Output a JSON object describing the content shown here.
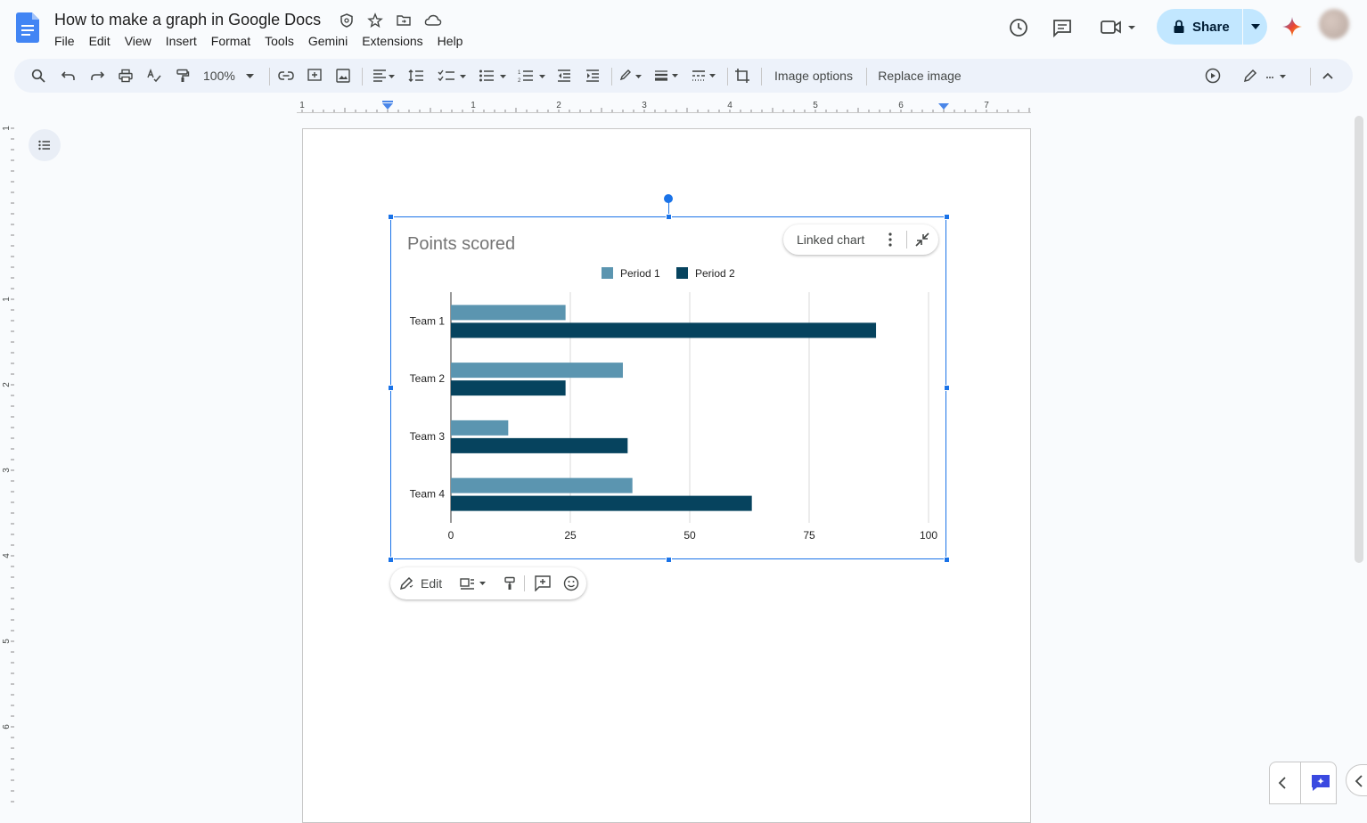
{
  "app": {
    "title": "How to make a graph in Google Docs",
    "menu": [
      "File",
      "Edit",
      "View",
      "Insert",
      "Format",
      "Tools",
      "Gemini",
      "Extensions",
      "Help"
    ],
    "share_label": "Share",
    "icons": {
      "title_icons": [
        "security-icon",
        "star-icon",
        "move-folder-icon",
        "cloud-status-icon"
      ],
      "right_icons": [
        "version-history-icon",
        "comments-icon",
        "meet-icon",
        "gemini-icon"
      ]
    }
  },
  "toolbar": {
    "zoom": "100%",
    "image_options": "Image options",
    "replace_image": "Replace image"
  },
  "ruler": {
    "h_labels": [
      "1",
      "1",
      "2",
      "3",
      "4",
      "5",
      "6",
      "7"
    ],
    "v_labels": [
      "1",
      "1",
      "2",
      "3",
      "4",
      "5",
      "6"
    ]
  },
  "chart_overlay": {
    "linked_chart_label": "Linked chart"
  },
  "image_toolbar": {
    "edit_label": "Edit"
  },
  "chart_data": {
    "type": "bar",
    "orientation": "horizontal",
    "title": "Points scored",
    "categories": [
      "Team 1",
      "Team 2",
      "Team 3",
      "Team 4"
    ],
    "series": [
      {
        "name": "Period 1",
        "values": [
          24,
          36,
          12,
          38
        ],
        "color": "#5b95b0"
      },
      {
        "name": "Period 2",
        "values": [
          89,
          24,
          37,
          63
        ],
        "color": "#06435e"
      }
    ],
    "xlim": [
      0,
      100
    ],
    "xticks": [
      "0",
      "25",
      "50",
      "75",
      "100"
    ],
    "grid": true,
    "legend": "top"
  }
}
